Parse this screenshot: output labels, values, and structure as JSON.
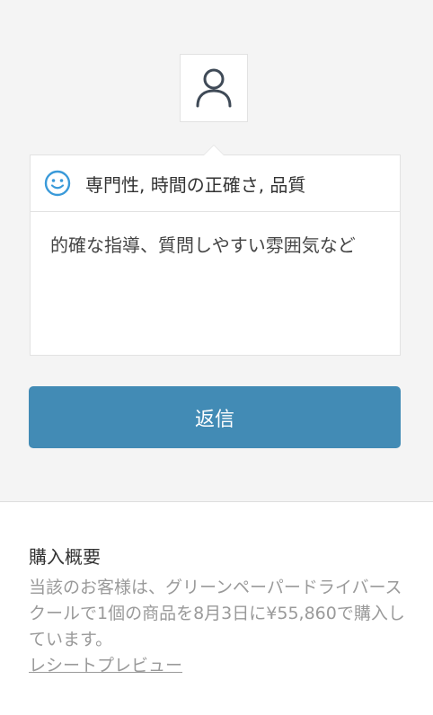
{
  "feedback": {
    "avatar_icon": "user-icon",
    "rating_icon": "smiley-icon",
    "tags": "専門性, 時間の正確さ, 品質",
    "comment": "的確な指導、質問しやすい雰囲気など"
  },
  "reply": {
    "label": "返信"
  },
  "purchase_summary": {
    "title": "購入概要",
    "description": "当該のお客様は、グリーンペーパードライバースクールで1個の商品を8月3日に¥55,860で購入しています。",
    "receipt_link": "レシートプレビュー"
  },
  "colors": {
    "accent": "#428bb5",
    "smiley": "#3a9ad9",
    "background": "#f4f4f4"
  }
}
